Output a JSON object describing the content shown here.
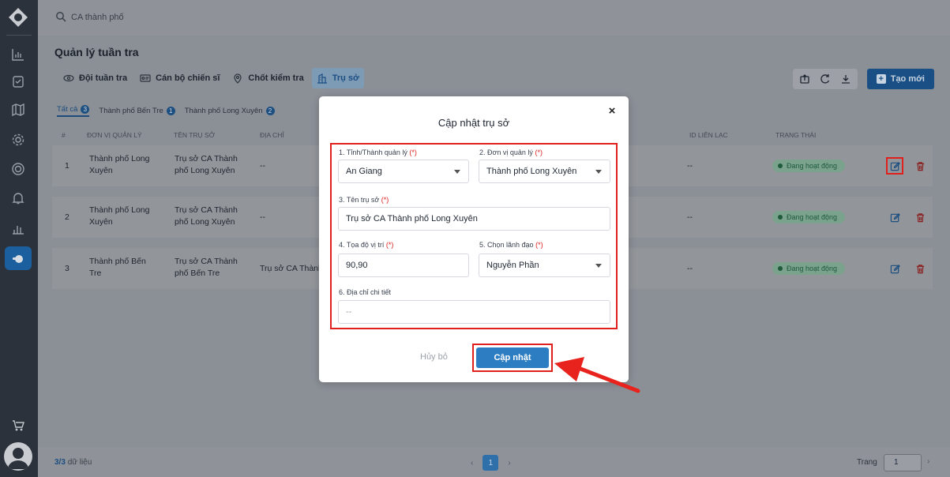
{
  "search": {
    "value": "CA thành phố"
  },
  "page": {
    "title": "Quản lý tuần tra"
  },
  "tabs": [
    {
      "label": "Đội tuần tra",
      "icon": "eye-icon"
    },
    {
      "label": "Cán bộ chiến sĩ",
      "icon": "id-card-icon"
    },
    {
      "label": "Chốt kiểm tra",
      "icon": "location-pin-icon"
    },
    {
      "label": "Trụ sở",
      "icon": "building-icon"
    }
  ],
  "toolbar": {
    "create_label": "Tạo mới"
  },
  "subtabs": [
    {
      "label": "Tất cả",
      "count": "3"
    },
    {
      "label": "Thành phố Bến Tre",
      "count": "1"
    },
    {
      "label": "Thành phố Long Xuyên",
      "count": "2"
    }
  ],
  "table": {
    "headers": [
      "#",
      "ĐƠN VỊ QUẢN LÝ",
      "TÊN TRỤ SỞ",
      "ĐỊA CHỈ",
      "ID LIÊN LẠC",
      "TRẠNG THÁI"
    ],
    "rows": [
      {
        "index": "1",
        "unit_line1": "Thành phố Long",
        "unit_line2": "Xuyên",
        "name_line1": "Trụ sở CA Thành",
        "name_line2": "phố Long Xuyên",
        "address": "--",
        "contact": "--",
        "status": "Đang hoạt động"
      },
      {
        "index": "2",
        "unit_line1": "Thành phố Long",
        "unit_line2": "Xuyên",
        "name_line1": "Trụ sở CA Thành",
        "name_line2": "phố Long Xuyên",
        "address": "--",
        "contact": "--",
        "status": "Đang hoạt động"
      },
      {
        "index": "3",
        "unit_line1": "Thành phố Bến",
        "unit_line2": "Tre",
        "name_line1": "Trụ sở CA Thành",
        "name_line2": "phố Bến Tre",
        "address": "Trụ sở CA Thành",
        "contact": "--",
        "status": "Đang hoạt động"
      }
    ]
  },
  "footer": {
    "count": "3/3",
    "count_suffix": "dữ liệu",
    "current_page": "1",
    "page_label": "Trang",
    "page_value": "1"
  },
  "modal": {
    "title": "Cập nhật trụ sở",
    "fields": {
      "province": {
        "label": "1. Tỉnh/Thành quản lý",
        "value": "An Giang"
      },
      "unit": {
        "label": "2. Đơn vị quản lý",
        "value": "Thành phố Long Xuyên"
      },
      "name": {
        "label": "3. Tên trụ sở",
        "value": "Trụ sở CA Thành phố Long Xuyên"
      },
      "coords": {
        "label": "4. Tọa độ vị trí",
        "value": "90,90"
      },
      "leader": {
        "label": "5. Chọn lãnh đạo",
        "value": "Nguyễn Phần"
      },
      "address": {
        "label": "6. Địa chỉ chi tiết",
        "placeholder": "--"
      }
    },
    "required_mark": "(*)",
    "cancel_label": "Hủy bỏ",
    "submit_label": "Cập nhật"
  },
  "colors": {
    "accent": "#2d7dc2",
    "highlight": "#e0201c",
    "sidebar": "#2b323b"
  }
}
